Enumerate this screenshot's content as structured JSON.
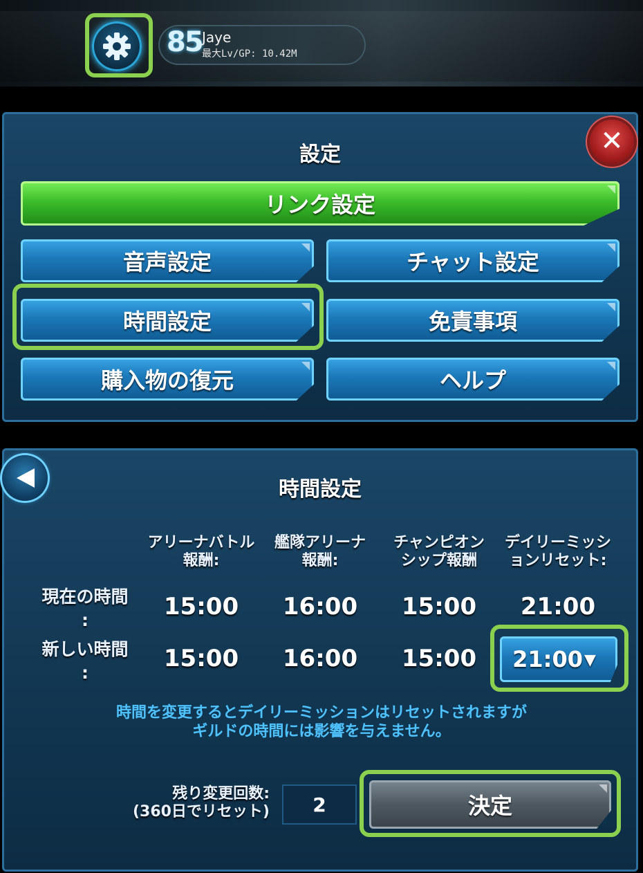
{
  "header": {
    "level": "85",
    "player_name": "Jaye",
    "gp_text": "最大Lv/GP: 10.42M"
  },
  "settings": {
    "title": "設定",
    "link_label": "リンク設定",
    "sound_label": "音声設定",
    "chat_label": "チャット設定",
    "time_label": "時間設定",
    "disclaimer_label": "免責事項",
    "restore_label": "購入物の復元",
    "help_label": "ヘルプ",
    "close_symbol": "✕"
  },
  "time_settings": {
    "title": "時間設定",
    "columns": [
      {
        "line1": "アリーナバトル",
        "line2": "報酬:"
      },
      {
        "line1": "艦隊アリーナ",
        "line2": "報酬:"
      },
      {
        "line1": "チャンピオン",
        "line2": "シップ報酬"
      },
      {
        "line1": "デイリーミッシ",
        "line2": "ョンリセット:"
      }
    ],
    "current_label_line1": "現在の時間",
    "current_label_line2": ":",
    "new_label_line1": "新しい時間",
    "new_label_line2": ":",
    "current_times": [
      "15:00",
      "16:00",
      "15:00",
      "21:00"
    ],
    "new_times": [
      "15:00",
      "16:00",
      "15:00"
    ],
    "selected_new_time": "21:00",
    "dropdown_symbol": "▼",
    "info_line1": "時間を変更するとデイリーミッションはリセットされますが",
    "info_line2": "ギルドの時間には影響を与えません。",
    "remaining_label_line1": "残り変更回数:",
    "remaining_label_line2": "(360日でリセット)",
    "remaining_count": "2",
    "confirm_label": "決定"
  },
  "colors": {
    "highlight": "#8bd14f",
    "accent_blue": "#3aa6e6",
    "accent_green": "#3cbd2b",
    "info_text": "#4fc3ff"
  },
  "icons": [
    "gear-icon",
    "close-icon",
    "back-arrow-icon",
    "dropdown-arrow-icon"
  ]
}
